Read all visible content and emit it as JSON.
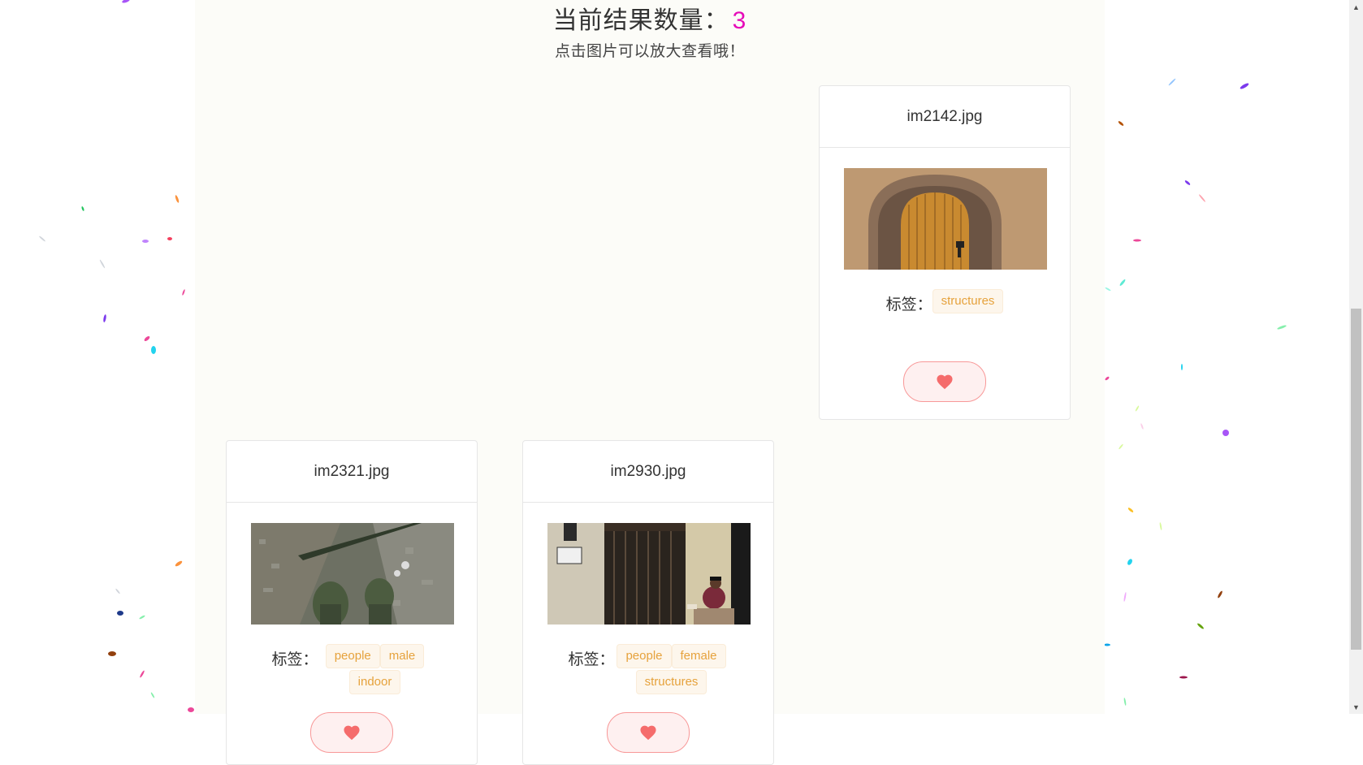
{
  "header": {
    "title_label": "当前结果数量：",
    "count": "3",
    "hint": "点击图片可以放大查看哦！"
  },
  "tags_label": "标签：",
  "cards": [
    {
      "filename": "im2142.jpg",
      "tags": [
        "structures"
      ],
      "image_alt": "arched wooden door in stone wall"
    },
    {
      "filename": "im2321.jpg",
      "tags": [
        "people",
        "male",
        "indoor"
      ],
      "image_alt": "aerial view of city with feet"
    },
    {
      "filename": "im2930.jpg",
      "tags": [
        "people",
        "female",
        "structures"
      ],
      "image_alt": "woman sitting by barred doorway"
    }
  ],
  "icons": {
    "like": "heart-icon"
  },
  "colors": {
    "count": "#e60bb9",
    "tag_text": "#e6a23c",
    "tag_bg": "#fdf6ec",
    "like_bg": "#fef0f0",
    "heart": "#f56c6c"
  }
}
